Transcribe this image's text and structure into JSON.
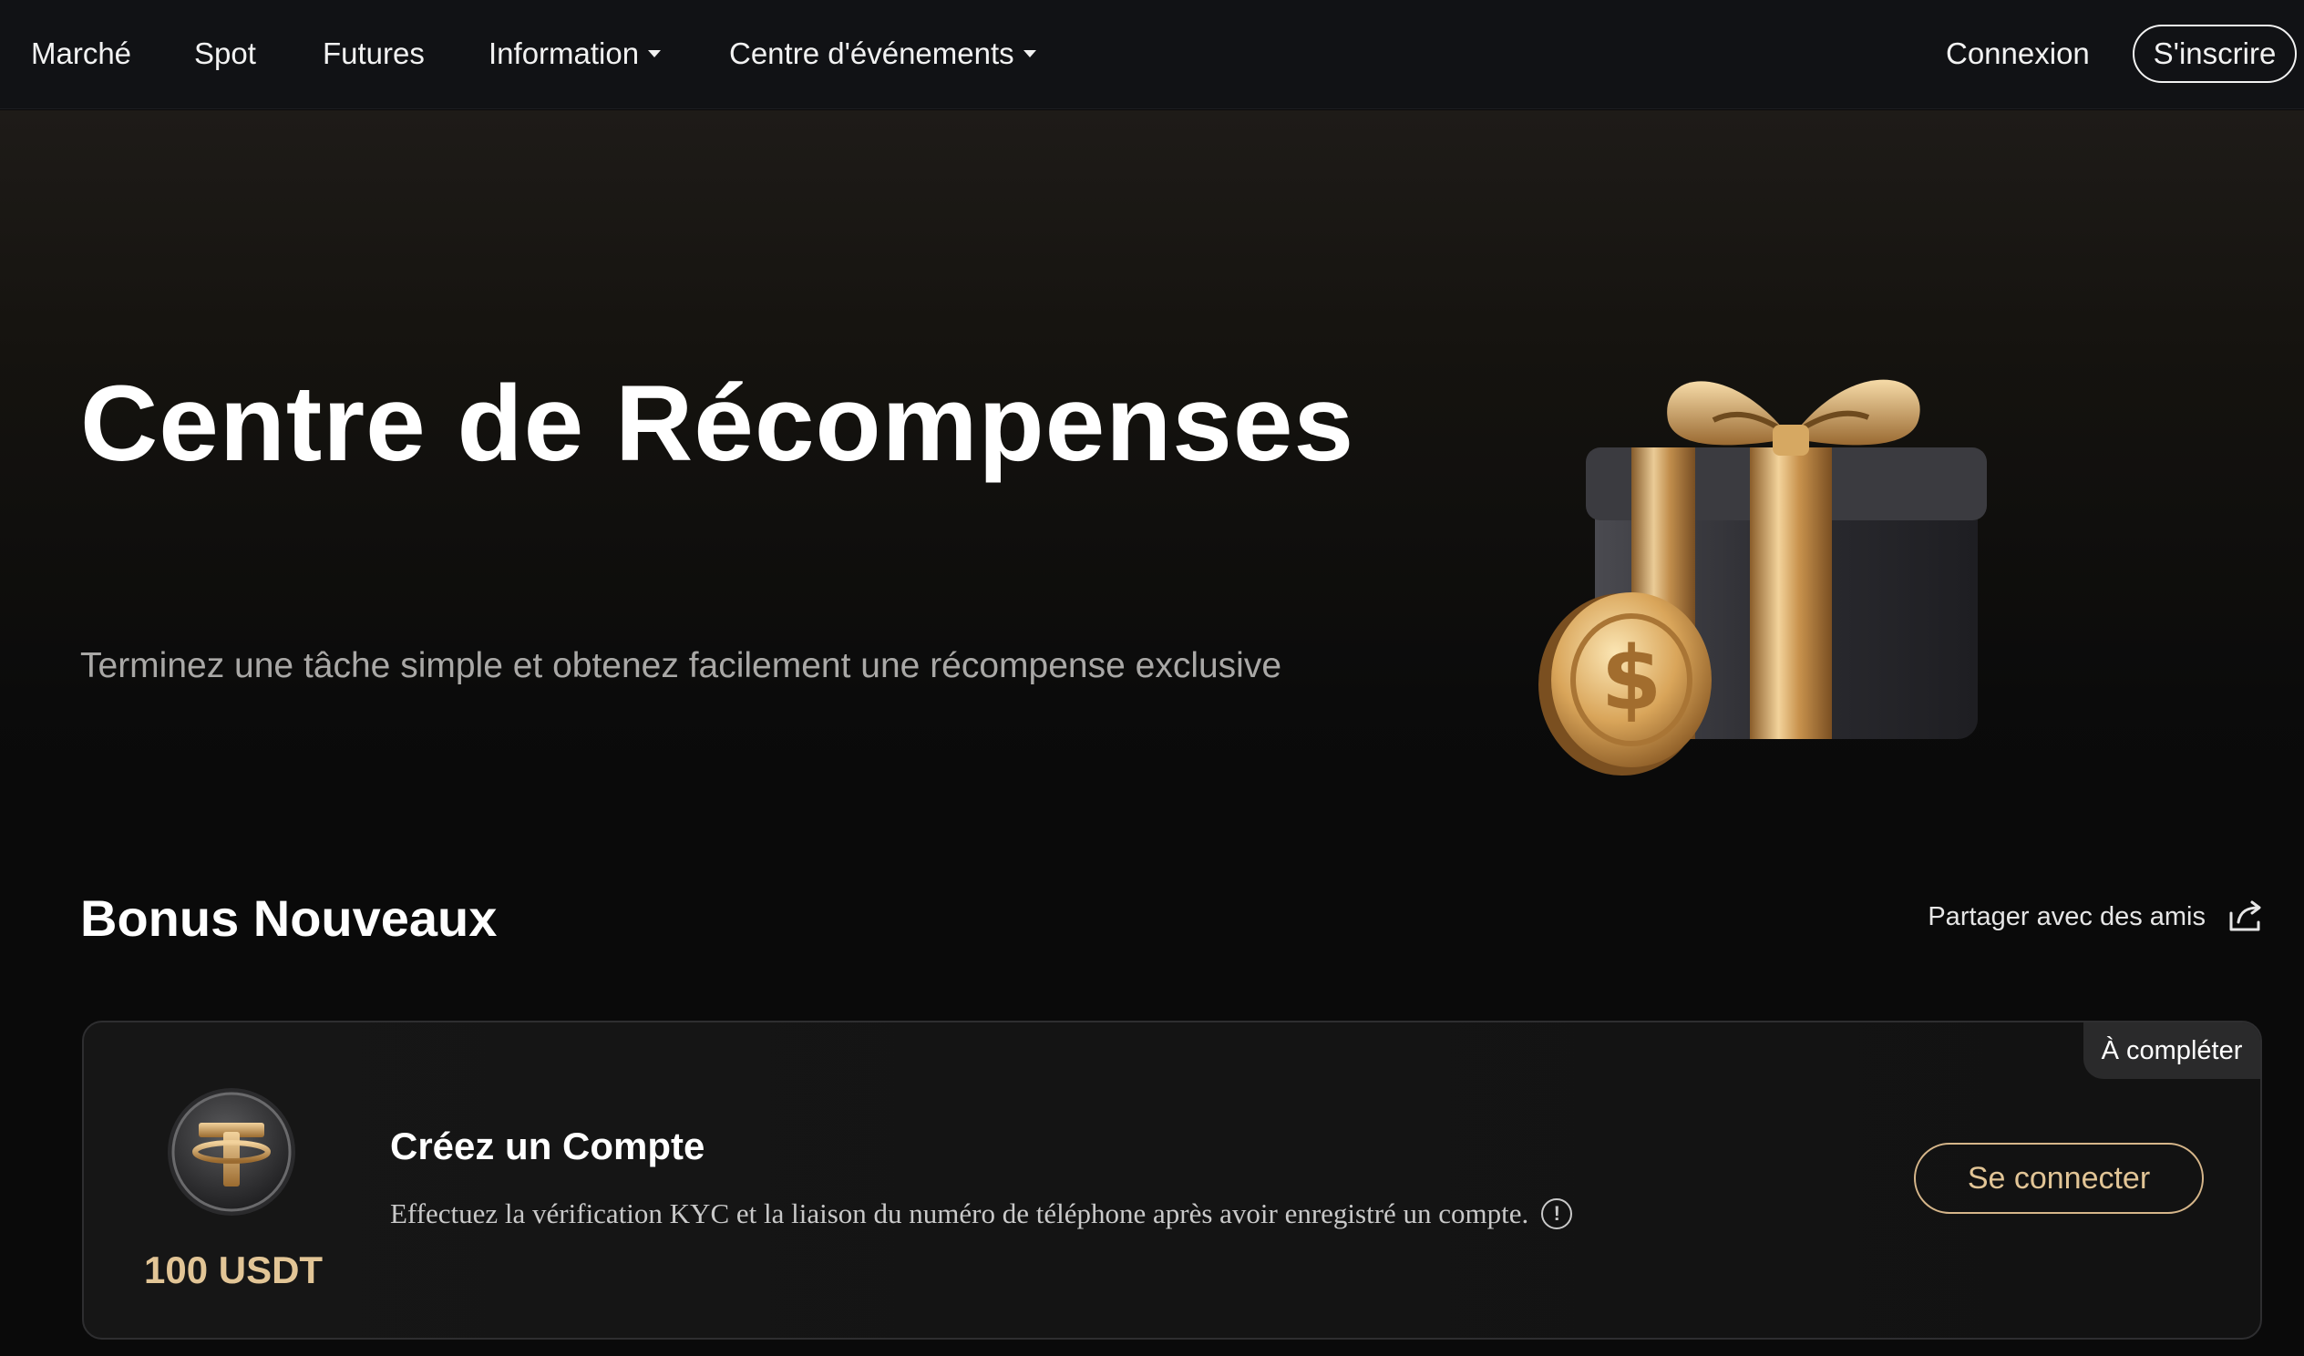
{
  "nav": {
    "items": [
      {
        "label": "Marché",
        "has_dropdown": false
      },
      {
        "label": "Spot",
        "has_dropdown": false
      },
      {
        "label": "Futures",
        "has_dropdown": false
      },
      {
        "label": "Information",
        "has_dropdown": true
      },
      {
        "label": "Centre d'événements",
        "has_dropdown": true
      }
    ],
    "login_label": "Connexion",
    "signup_label": "S'inscrire"
  },
  "hero": {
    "title": "Centre de Récompenses",
    "subtitle": "Terminez une tâche simple et obtenez facilement une récompense exclusive",
    "illustration": "gift-box-with-gold-coin"
  },
  "section": {
    "title": "Bonus Nouveaux",
    "share_label": "Partager avec des amis",
    "share_icon": "share-icon"
  },
  "task_card": {
    "status": "À compléter",
    "token_icon": "usdt-coin-icon",
    "reward": "100 USDT",
    "title": "Créez un Compte",
    "description": "Effectuez la vérification KYC et la liaison du numéro de téléphone après avoir enregistré un compte.",
    "info_icon": "info-icon",
    "action_label": "Se connecter"
  },
  "colors": {
    "background": "#0a0a0a",
    "nav_background": "#111215",
    "gold_accent": "#e2c596",
    "subtitle_gray": "#a9a8a6"
  }
}
